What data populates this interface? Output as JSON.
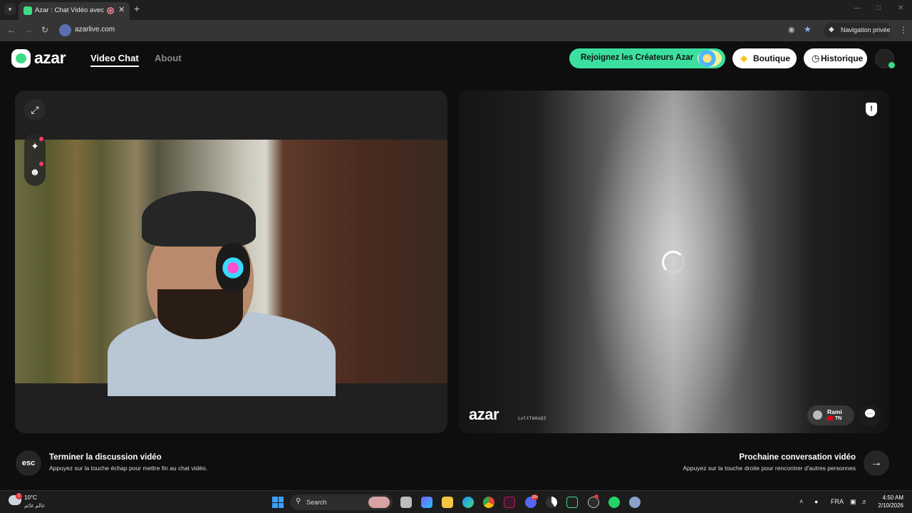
{
  "browser": {
    "tab_title": "Azar : Chat Vidéo avec de n",
    "url": "azarlive.com",
    "incognito_label": "Navigation privée"
  },
  "header": {
    "logo_text": "azar",
    "nav": {
      "video_chat": "Video Chat",
      "about": "About"
    },
    "creators_button": "Rejoignez les Créateurs Azar",
    "shop_button": "Boutique",
    "history_button": "Historique"
  },
  "remote": {
    "watermark": "azar",
    "watermark_id": "LoltTmXoQ3",
    "user_name": "Rami",
    "user_country": "TN"
  },
  "actions": {
    "esc_key": "esc",
    "end_title": "Terminer la discussion vidéo",
    "end_hint": "Appuyez sur la touche échap pour mettre fin au chat vidéo.",
    "next_title": "Prochaine conversation vidéo",
    "next_hint": "Appuyez sur la touche droite pour rencontrer d'autres personnes"
  },
  "taskbar": {
    "weather_temp": "10°C",
    "weather_desc": "عالم غائم",
    "weather_badge": "1",
    "search_label": "Search",
    "discord_badge": "10+",
    "language": "FRA",
    "time": "4:50 AM",
    "date": "2/10/2026"
  },
  "colors": {
    "accent_green": "#3be0a0",
    "notification_red": "#ff3b5c",
    "background": "#0e0e0e"
  }
}
